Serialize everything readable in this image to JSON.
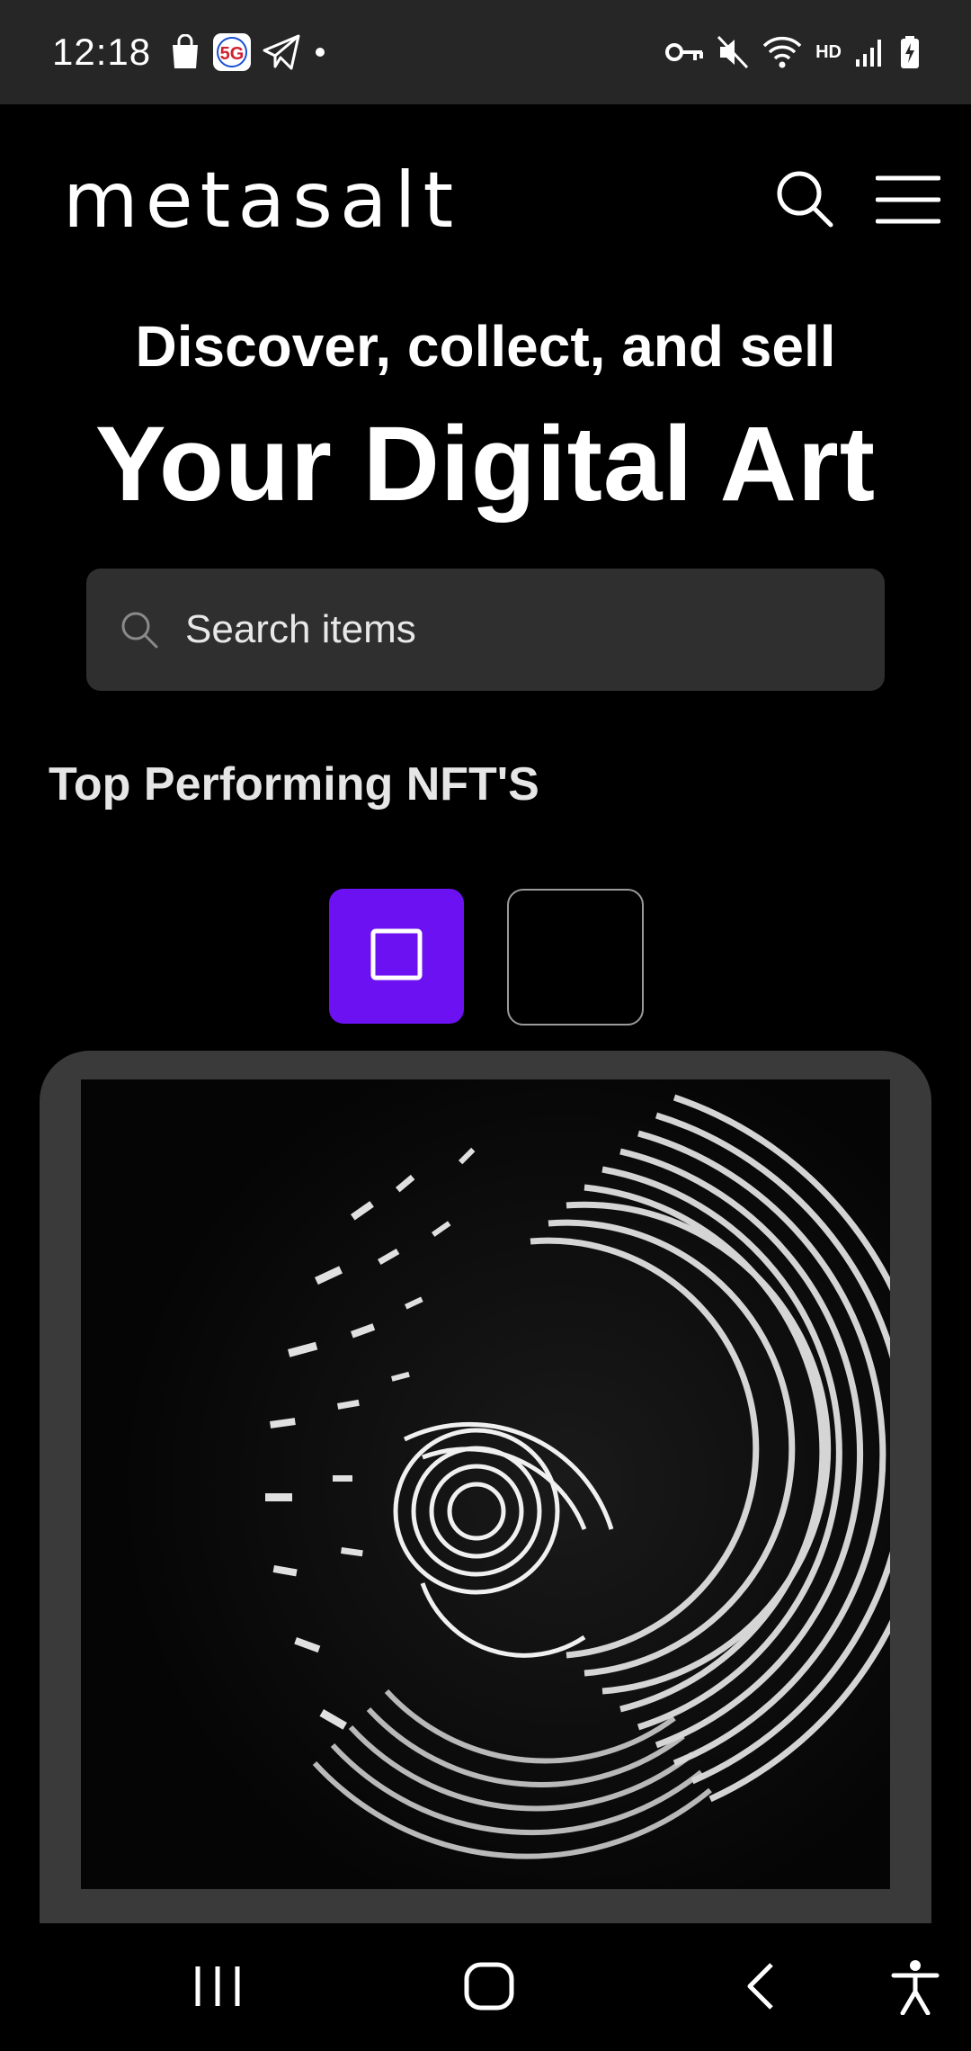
{
  "status_bar": {
    "time": "12:18",
    "left_icons": [
      "shopping-bag-icon",
      "5g-app-icon",
      "telegram-icon",
      "dot-icon"
    ],
    "right_icons": [
      "vpn-key-icon",
      "mute-icon",
      "wifi-icon",
      "hd-icon",
      "signal-icon",
      "battery-charging-icon"
    ],
    "hd_label": "HD"
  },
  "header": {
    "logo_text": "metasalt",
    "search_icon": "search-icon",
    "menu_icon": "hamburger-menu-icon"
  },
  "hero": {
    "subtitle": "Discover, collect, and sell",
    "title": "Your Digital Art"
  },
  "search": {
    "placeholder": "Search items",
    "value": ""
  },
  "section": {
    "title": "Top Performing NFT'S"
  },
  "view_toggle": {
    "options": [
      "single-view-icon",
      "grid-view-icon"
    ],
    "active_index": 0
  },
  "colors": {
    "accent": "#6c12f2",
    "background": "#000000",
    "status_bar": "#262626",
    "search_bg": "#2f2f2f",
    "card_bg": "#3a3a3a"
  },
  "nav_bar": {
    "icons": [
      "recent-apps-icon",
      "home-icon",
      "back-icon",
      "accessibility-icon"
    ]
  }
}
